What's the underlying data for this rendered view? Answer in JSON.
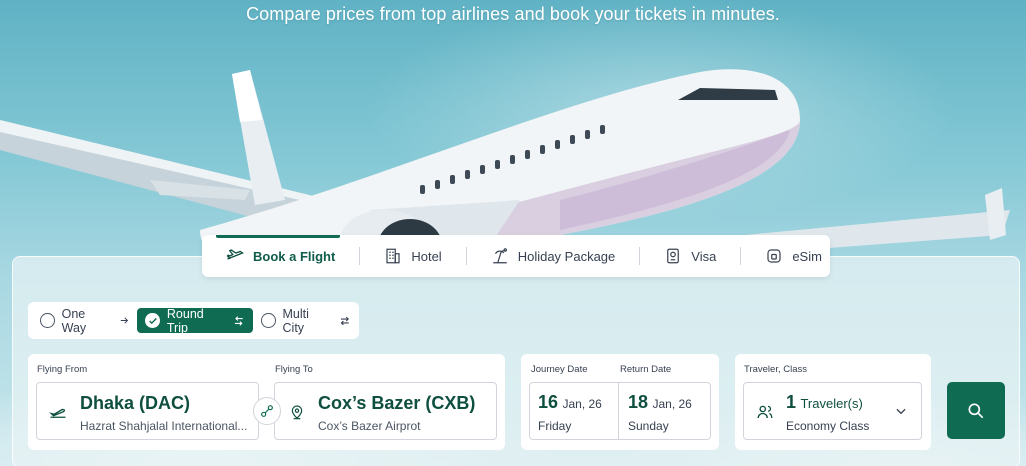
{
  "hero": {
    "subtitle": "Compare prices from top airlines and book your tickets in minutes."
  },
  "tabs": [
    {
      "label": "Book a Flight",
      "icon": "plane-icon",
      "active": true
    },
    {
      "label": "Hotel",
      "icon": "hotel-icon",
      "active": false
    },
    {
      "label": "Holiday Package",
      "icon": "beach-icon",
      "active": false
    },
    {
      "label": "Visa",
      "icon": "passport-icon",
      "active": false
    },
    {
      "label": "eSim",
      "icon": "sim-icon",
      "active": false
    }
  ],
  "trip_type": {
    "options": [
      {
        "label": "One Way",
        "icon": "arrow-right-icon",
        "selected": false
      },
      {
        "label": "Round Trip",
        "icon": "return-arrow-icon",
        "selected": true
      },
      {
        "label": "Multi City",
        "icon": "swap-arrows-icon",
        "selected": false
      }
    ]
  },
  "from": {
    "label": "Flying From",
    "city": "Dhaka (DAC)",
    "airport": "Hazrat Shahjalal International..."
  },
  "to": {
    "label": "Flying To",
    "city": "Cox’s Bazer (CXB)",
    "airport": "Cox’s Bazer Airprot"
  },
  "journey": {
    "label": "Journey Date",
    "day": "16",
    "month_year": "Jan, 26",
    "weekday": "Friday"
  },
  "return": {
    "label": "Return Date",
    "day": "18",
    "month_year": "Jan, 26",
    "weekday": "Sunday"
  },
  "traveler": {
    "label": "Traveler, Class",
    "count": "1",
    "unit": "Traveler(s)",
    "class": "Economy Class"
  },
  "colors": {
    "brand": "#0f6b52",
    "brand_text": "#0f4f3f",
    "sky": "#86c9d6"
  }
}
